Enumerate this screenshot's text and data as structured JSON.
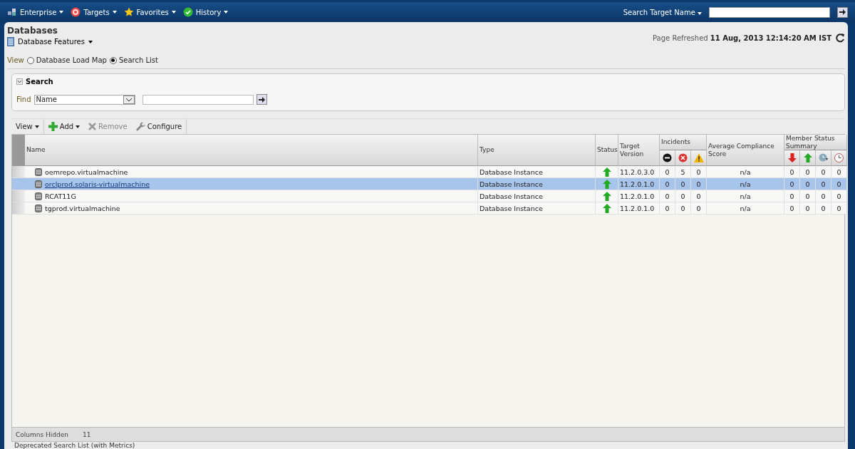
{
  "nav": {
    "menus": [
      {
        "label": "Enterprise"
      },
      {
        "label": "Targets"
      },
      {
        "label": "Favorites"
      },
      {
        "label": "History"
      }
    ],
    "search_label": "Search Target Name"
  },
  "page": {
    "title": "Databases",
    "features_menu": "Database Features",
    "refreshed_label": "Page Refreshed",
    "refreshed_time": "11 Aug, 2013 12:14:20 AM IST"
  },
  "view": {
    "label": "View",
    "options": [
      {
        "label": "Database Load Map",
        "selected": false
      },
      {
        "label": "Search List",
        "selected": true
      }
    ]
  },
  "search": {
    "title": "Search",
    "expanded": true,
    "find_label": "Find",
    "find_field": "Name"
  },
  "toolbar": [
    {
      "label": "View",
      "kind": "menu",
      "disabled": false
    },
    {
      "label": "Add",
      "kind": "add",
      "disabled": false
    },
    {
      "label": "Remove",
      "kind": "remove",
      "disabled": true
    },
    {
      "label": "Configure",
      "kind": "configure",
      "disabled": false
    }
  ],
  "table": {
    "columns": {
      "name": "Name",
      "type": "Type",
      "status": "Status",
      "version": "Target Version",
      "incidents": "Incidents",
      "compliance": "Average Compliance Score",
      "member": "Member Status Summary"
    },
    "rows": [
      {
        "name": "oemrepo.virtualmachine",
        "type": "Database Instance",
        "status_up": true,
        "version": "11.2.0.3.0",
        "incidents": [
          "0",
          "5",
          "0"
        ],
        "compliance": "n/a",
        "member": [
          "0",
          "0",
          "0",
          "0"
        ],
        "selected": false
      },
      {
        "name": "orclprod.solaris-virtualmachine",
        "type": "Database Instance",
        "status_up": true,
        "version": "11.2.0.1.0",
        "incidents": [
          "0",
          "0",
          "0"
        ],
        "compliance": "n/a",
        "member": [
          "0",
          "0",
          "0",
          "0"
        ],
        "selected": true
      },
      {
        "name": "RCAT11G",
        "type": "Database Instance",
        "status_up": true,
        "version": "11.2.0.1.0",
        "incidents": [
          "0",
          "0",
          "0"
        ],
        "compliance": "n/a",
        "member": [
          "0",
          "0",
          "0",
          "0"
        ],
        "selected": false
      },
      {
        "name": "tgprod.virtualmachine",
        "type": "Database Instance",
        "status_up": true,
        "version": "11.2.0.1.0",
        "incidents": [
          "0",
          "0",
          "0"
        ],
        "compliance": "n/a",
        "member": [
          "0",
          "0",
          "0",
          "0"
        ],
        "selected": false
      }
    ]
  },
  "footer": {
    "label": "Columns Hidden",
    "value": "11"
  },
  "caption": "Deprecated Search List (with Metrics)"
}
